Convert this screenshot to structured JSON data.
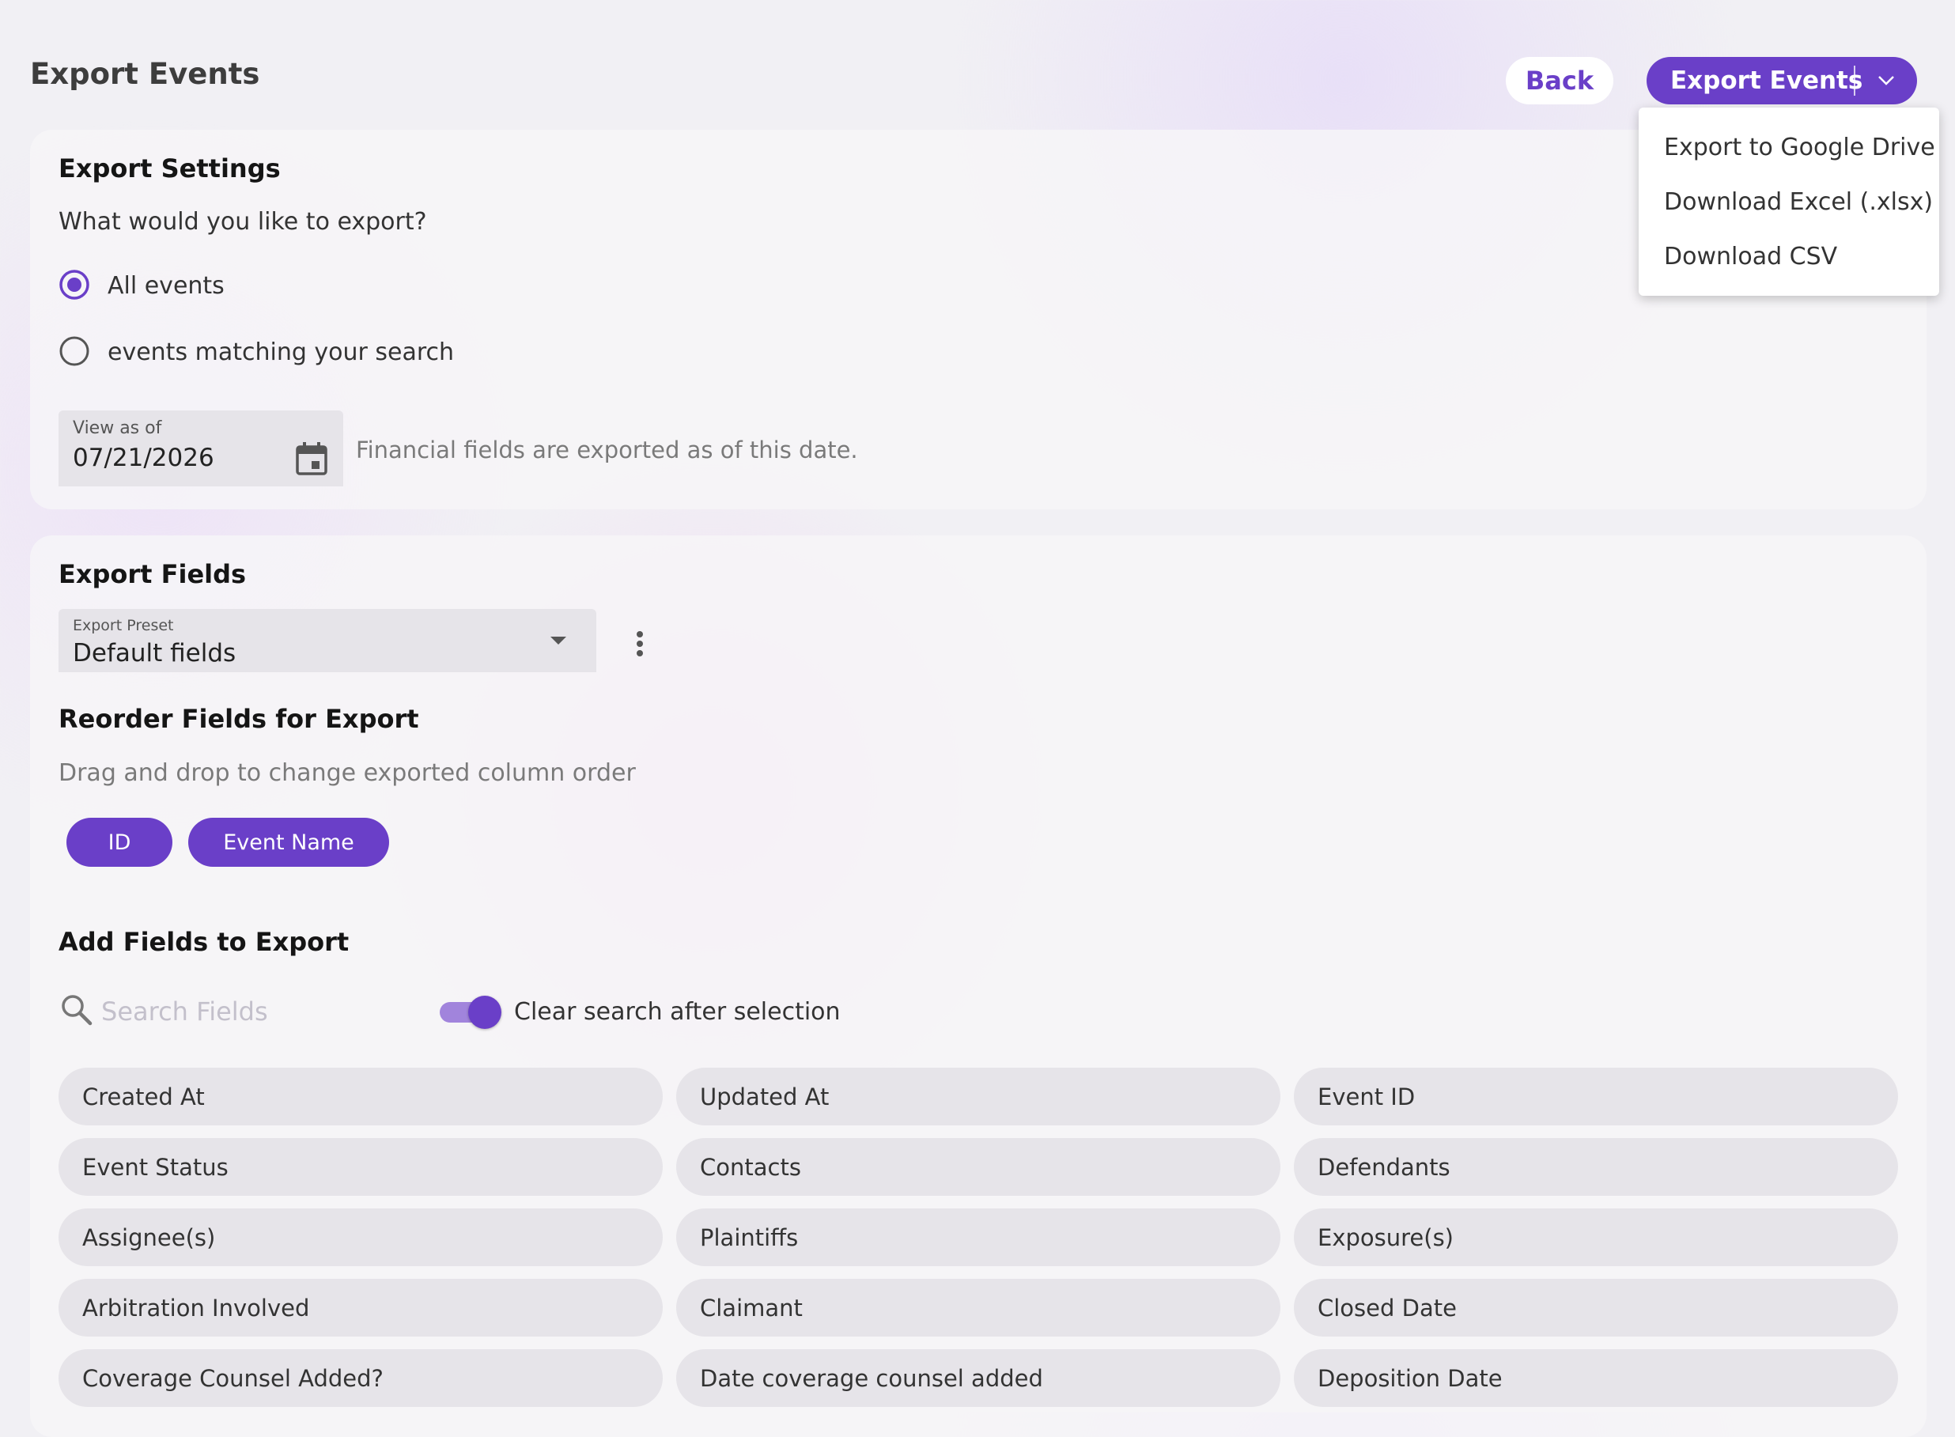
{
  "header": {
    "title": "Export Events",
    "back_label": "Back",
    "export_label": "Export Events"
  },
  "export_menu": {
    "items": [
      "Export to Google Drive",
      "Download Excel (.xlsx)",
      "Download CSV"
    ]
  },
  "settings": {
    "title": "Export Settings",
    "question": "What would you like to export?",
    "options": [
      {
        "label": "All events",
        "selected": true
      },
      {
        "label": "events matching your search",
        "selected": false
      }
    ],
    "date_label": "View as of",
    "date_value": "07/21/2026",
    "date_hint": "Financial fields are exported as of this date."
  },
  "fields_section": {
    "title": "Export Fields",
    "preset_label": "Export Preset",
    "preset_value": "Default fields",
    "reorder_title": "Reorder Fields for Export",
    "reorder_hint": "Drag and drop to change exported column order",
    "selected_chips": [
      "ID",
      "Event Name"
    ],
    "add_title": "Add Fields to Export",
    "search_placeholder": "Search Fields",
    "toggle_label": "Clear search after selection",
    "toggle_on": true,
    "available": [
      "Created At",
      "Updated At",
      "Event ID",
      "Event Status",
      "Contacts",
      "Defendants",
      "Assignee(s)",
      "Plaintiffs",
      "Exposure(s)",
      "Arbitration Involved",
      "Claimant",
      "Closed Date",
      "Coverage Counsel Added?",
      "Date coverage counsel added",
      "Deposition Date"
    ]
  },
  "colors": {
    "accent": "#6a3fc8",
    "toggle_track": "#a184dc",
    "field_bg": "#e6e4e9"
  }
}
